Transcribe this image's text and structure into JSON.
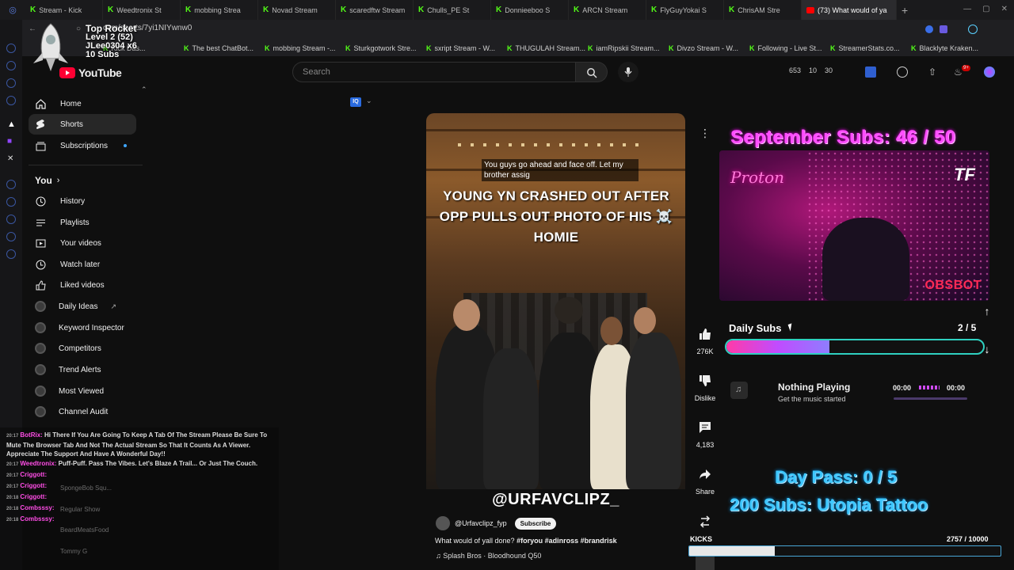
{
  "browser": {
    "tabs": [
      {
        "label": "Stream - Kick",
        "favicon": "kick"
      },
      {
        "label": "Weedtronix St",
        "favicon": "kick"
      },
      {
        "label": "mobbing Strea",
        "favicon": "kick"
      },
      {
        "label": "Novad Stream",
        "favicon": "kick"
      },
      {
        "label": "scaredftw Stream",
        "favicon": "kick"
      },
      {
        "label": "Chulls_PE St",
        "favicon": "kick"
      },
      {
        "label": "Donnieeboo S",
        "favicon": "kick"
      },
      {
        "label": "ARCN Stream",
        "favicon": "kick"
      },
      {
        "label": "FlyGuyYokai S",
        "favicon": "kick"
      },
      {
        "label": "ChrisAM Stre",
        "favicon": "kick"
      },
      {
        "label": "(73) What would of ya",
        "favicon": "youtube",
        "active": true
      }
    ],
    "url": "com/shorts/7yi1NIYwnw0",
    "bookmarks": [
      "Kick Das...",
      "The best ChatBot...",
      "mobbing Stream -...",
      "Sturkgotwork Stre...",
      "sxript Stream - W...",
      "THUGULAH Stream...",
      "iamRipskii Stream...",
      "Divzo Stream - W...",
      "Following - Live St...",
      "StreamerStats.co...",
      "Blacklyte Kraken..."
    ]
  },
  "rocket_overlay": {
    "title": "Top Rocket",
    "level": "Level 2  (52)",
    "user": "JLee0304 x6",
    "subs": "10 Subs"
  },
  "youtube": {
    "logo_text": "YouTube",
    "search_placeholder": "Search",
    "header_stats": {
      "a": "653",
      "b": "10",
      "c": "30"
    },
    "notif_badge": "9+",
    "sidebar": {
      "main": [
        {
          "label": "Home",
          "icon": "home-icon"
        },
        {
          "label": "Shorts",
          "icon": "shorts-icon",
          "active": true
        },
        {
          "label": "Subscriptions",
          "icon": "subscriptions-icon"
        }
      ],
      "you_header": "You",
      "you": [
        {
          "label": "History",
          "icon": "history-icon"
        },
        {
          "label": "Playlists",
          "icon": "playlists-icon"
        },
        {
          "label": "Your videos",
          "icon": "your-videos-icon"
        },
        {
          "label": "Watch later",
          "icon": "watch-later-icon"
        },
        {
          "label": "Liked videos",
          "icon": "liked-icon"
        }
      ],
      "tools": [
        {
          "label": "Daily Ideas"
        },
        {
          "label": "Keyword Inspector"
        },
        {
          "label": "Competitors"
        },
        {
          "label": "Trend Alerts"
        },
        {
          "label": "Most Viewed"
        },
        {
          "label": "Channel Audit"
        }
      ],
      "faded": [
        "SpongeBob Squ...",
        "Regular Show",
        "BeardMeatsFood",
        "Tommy G"
      ]
    },
    "video": {
      "caption": "You guys go ahead and face off. Let my brother assig",
      "headline": "YOUNG YN CRASHED OUT AFTER OPP PULLS OUT PHOTO OF HIS ☠️ HOMIE",
      "watermark": "@URFAVCLIPZ_",
      "channel": "@Urfavclipz_fyp",
      "subscribe": "Subscribe",
      "description": "What would of yall done?",
      "hashtags": "#foryou #adinross #brandrisk",
      "music": "Splash Bros · Bloodhound Q50"
    },
    "actions": {
      "likes": "276K",
      "dislike": "Dislike",
      "comments": "4,183",
      "share": "Share"
    }
  },
  "chat": [
    {
      "time": "20:17",
      "user": "BotRix",
      "text": "Hi There If You Are Going To Keep A Tab Of The Stream Please Be Sure To Mute The Browser Tab And Not The Actual Stream So That It Counts As A Viewer. Appreciate The Support And Have A Wonderful Day!!"
    },
    {
      "time": "20:17",
      "user": "Weedtronix",
      "text": "Puff-Puff. Pass The Vibes. Let's Blaze A Trail... Or Just The Couch."
    },
    {
      "time": "20:17",
      "user": "Criggott",
      "text": ""
    },
    {
      "time": "20:17",
      "user": "Criggott",
      "text": ""
    },
    {
      "time": "20:18",
      "user": "Criggott",
      "text": ""
    },
    {
      "time": "20:18",
      "user": "Combsssy",
      "text": ""
    },
    {
      "time": "20:18",
      "user": "Combsssy",
      "text": ""
    }
  ],
  "stream_overlay": {
    "sept_goal": "September Subs: 46 / 50",
    "webcam": {
      "neon_sign": "Proton",
      "brand": "OBSBOT",
      "logo": "TF"
    },
    "daily_label": "Daily Subs",
    "daily_count": "2 / 5",
    "daily_progress": 0.4,
    "music_title": "Nothing Playing",
    "music_sub": "Get the music started",
    "music_time_start": "00:00",
    "music_time_end": "00:00",
    "day_pass": "Day Pass: 0 / 5",
    "sub_goal": "200 Subs: Utopia Tattoo",
    "kicks_label": "KICKS",
    "kicks_count": "2757  / 10000",
    "kicks_progress": 0.2757
  },
  "colors": {
    "kick_green": "#53fc18",
    "yt_red": "#ff0033",
    "neon_pink": "#ff4dff",
    "neon_blue": "#3ec8ff"
  }
}
